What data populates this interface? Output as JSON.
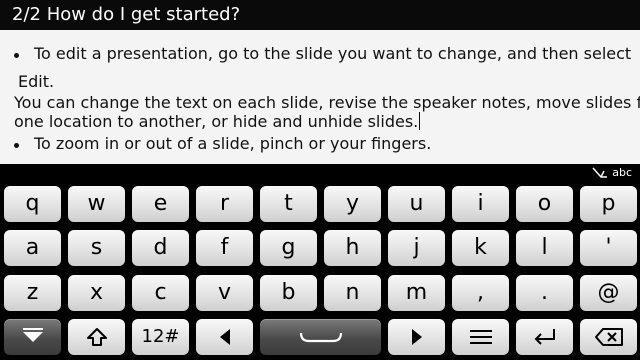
{
  "titlebar": {
    "title": "2/2 How do I get started?"
  },
  "document": {
    "line1": "To edit a presentation, go to the slide you want to change, and then select",
    "line2": "Edit.",
    "line3": "You can change the text on each slide, revise the speaker notes, move slides from",
    "line4": "one location to another, or hide and unhide slides.",
    "line5": "To zoom in or out of a slide, pinch or  your fingers."
  },
  "input_indicator": {
    "mode": "abc",
    "icon": "pen-icon"
  },
  "keyboard": {
    "row1": [
      "q",
      "w",
      "e",
      "r",
      "t",
      "y",
      "u",
      "i",
      "o",
      "p"
    ],
    "row2": [
      "a",
      "s",
      "d",
      "f",
      "g",
      "h",
      "j",
      "k",
      "l",
      "'"
    ],
    "row3": [
      "z",
      "x",
      "c",
      "v",
      "b",
      "n",
      "m",
      ",",
      ".",
      "@"
    ],
    "row4": {
      "hide_icon": "hide-keyboard-icon",
      "shift_icon": "shift-icon",
      "symbols_label": "12#",
      "left_icon": "arrow-left-icon",
      "space_icon": "space-icon",
      "right_icon": "arrow-right-icon",
      "menu_icon": "menu-icon",
      "enter_icon": "enter-icon",
      "backspace_icon": "backspace-icon"
    }
  }
}
